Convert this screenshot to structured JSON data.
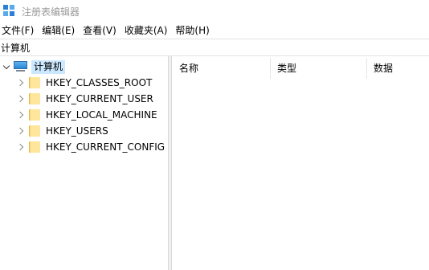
{
  "window": {
    "title": "注册表编辑器",
    "icon": "regedit-icon"
  },
  "menu": [
    "文件(F)",
    "编辑(E)",
    "查看(V)",
    "收藏夹(A)",
    "帮助(H)"
  ],
  "address": "计算机",
  "tree": {
    "root": {
      "label": "计算机",
      "icon": "computer-icon",
      "expanded": true,
      "selected": true
    },
    "children": [
      {
        "label": "HKEY_CLASSES_ROOT",
        "icon": "folder-icon"
      },
      {
        "label": "HKEY_CURRENT_USER",
        "icon": "folder-icon"
      },
      {
        "label": "HKEY_LOCAL_MACHINE",
        "icon": "folder-icon"
      },
      {
        "label": "HKEY_USERS",
        "icon": "folder-icon"
      },
      {
        "label": "HKEY_CURRENT_CONFIG",
        "icon": "folder-icon"
      }
    ]
  },
  "list": {
    "columns": [
      "名称",
      "类型",
      "数据"
    ]
  },
  "colors": {
    "selection": "#cce8ff",
    "title_text": "#9a9a9a",
    "app_icon_blue": "#2b7fd6",
    "folder_yellow": "#ffe69a"
  }
}
